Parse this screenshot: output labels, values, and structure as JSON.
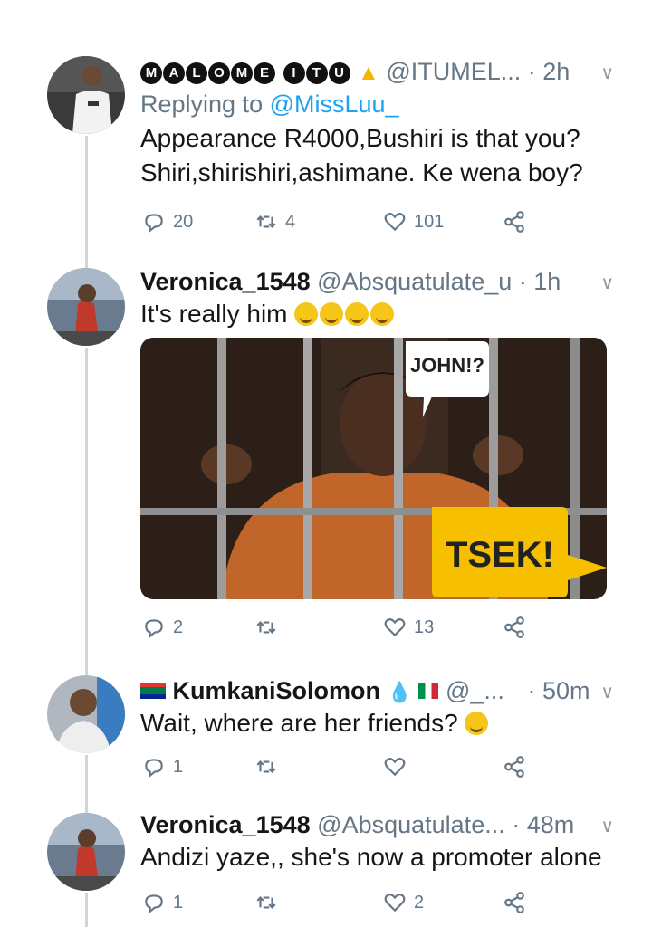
{
  "tweets": [
    {
      "name": "MALOME ITU",
      "name_letters": [
        "M",
        "A",
        "L",
        "O",
        "M",
        "E",
        "I",
        "T",
        "U"
      ],
      "handle": "@ITUMEL...",
      "sep": "·",
      "time": "2h",
      "replying_label": "Replying to",
      "replying_to": "@MissLuu_",
      "text_lines": [
        "Appearance R4000,Bushiri is that you?",
        "Shiri,shirishiri,ashimane. Ke wena boy?"
      ],
      "replies": "20",
      "retweets": "4",
      "likes": "101"
    },
    {
      "name": "Veronica_1548",
      "handle": "@Absquatulate_u",
      "sep": "·",
      "time": "1h",
      "text": "It's really him",
      "emoji": "rolling-on-floor-laughing x4",
      "media": {
        "bubble_top": "JOHN!?",
        "bubble_bottom": "TSEK!"
      },
      "replies": "2",
      "retweets": "",
      "likes": "13"
    },
    {
      "name": "KumkaniSolomon",
      "handle": "@_...",
      "sep": "·",
      "time": "50m",
      "text": "Wait, where are her friends?",
      "emoji": "thinking-face",
      "replies": "1",
      "retweets": "",
      "likes": ""
    },
    {
      "name": "Veronica_1548",
      "handle": "@Absquatulate...",
      "sep": "·",
      "time": "48m",
      "text": "Andizi yaze,, she's now a promoter alone",
      "replies": "1",
      "retweets": "",
      "likes": "2"
    }
  ],
  "colors": {
    "secondary": "#657786",
    "link": "#1da1f2",
    "thread": "#ccd6dd"
  },
  "icons": [
    "reply-icon",
    "retweet-icon",
    "like-icon",
    "share-icon",
    "chevron-down-icon"
  ]
}
